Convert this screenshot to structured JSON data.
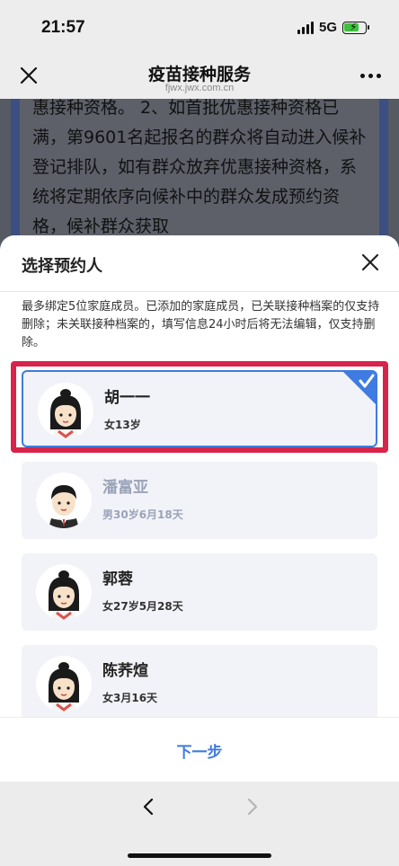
{
  "status": {
    "time": "21:57",
    "network": "5G"
  },
  "nav": {
    "title": "疫苗接种服务",
    "url": "fjwx.jwx.com.cn"
  },
  "background_text": "惠接种资格。 2、如首批优惠接种资格已满，第9601名起报名的群众将自动进入候补登记排队，如有群众放弃优惠接种资格，系统将定期依序向候补中的群众发成预约资格，候补群众获取",
  "sheet": {
    "title": "选择预约人",
    "notice": "最多绑定5位家庭成员。已添加的家庭成员，已关联接种档案的仅支持删除；未关联接种档案的，填写信息24小时后将无法编辑，仅支持删除。",
    "members": [
      {
        "name": "胡一一",
        "info": "女13岁",
        "avatar": "girl-avatar-icon",
        "state": "selected"
      },
      {
        "name": "潘富亚",
        "info": "男30岁6月18天",
        "avatar": "boy-avatar-icon",
        "state": "disabled"
      },
      {
        "name": "郭蓉",
        "info": "女27岁5月28天",
        "avatar": "girl-avatar-icon",
        "state": "normal"
      },
      {
        "name": "陈荞煊",
        "info": "女3月16天",
        "avatar": "girl-avatar-icon",
        "state": "normal"
      }
    ],
    "next_label": "下一步"
  },
  "colors": {
    "accent": "#3f7be0",
    "highlight": "#d7244a",
    "disabled_text": "#9aa3b8"
  }
}
